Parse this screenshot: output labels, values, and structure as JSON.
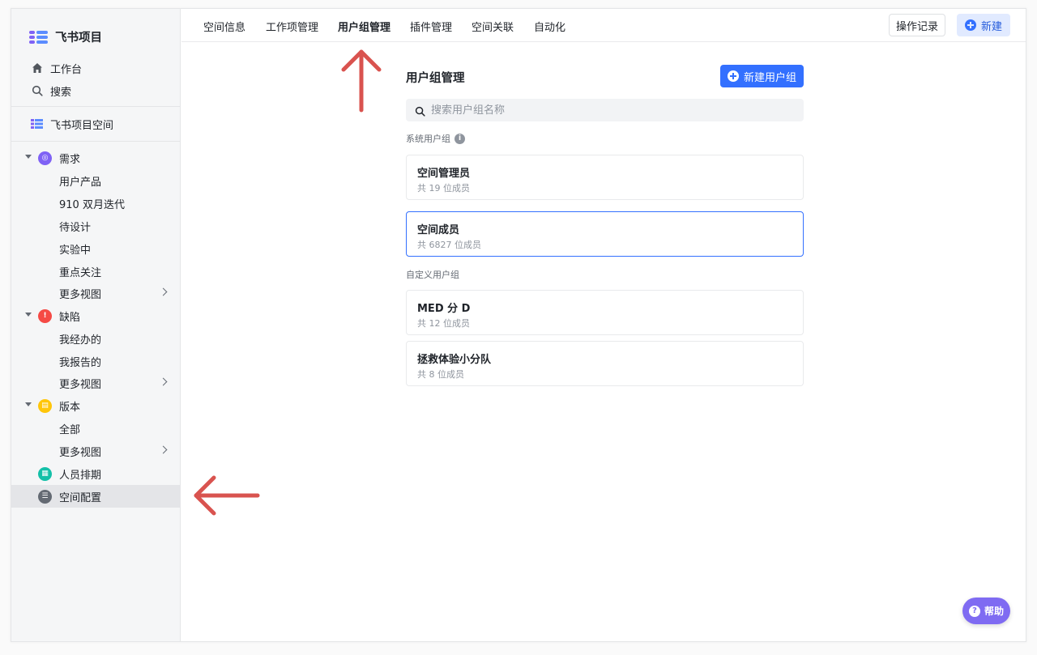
{
  "app": {
    "name": "飞书项目"
  },
  "sidebar": {
    "home": "工作台",
    "search": "搜索",
    "space": "飞书项目空间",
    "categories": [
      {
        "label": "需求",
        "color": "#7f62f5",
        "items": [
          "用户产品",
          "910 双月迭代",
          "待设计",
          "实验中",
          "重点关注",
          "更多视图"
        ]
      },
      {
        "label": "缺陷",
        "color": "#f54a45",
        "items": [
          "我经办的",
          "我报告的",
          "更多视图"
        ]
      },
      {
        "label": "版本",
        "color": "#ffc60a",
        "items": [
          "全部",
          "更多视图"
        ]
      }
    ],
    "schedule": "人员排期",
    "config": "空间配置"
  },
  "topnav": {
    "tabs": [
      "空间信息",
      "工作项管理",
      "用户组管理",
      "插件管理",
      "空间关联",
      "自动化"
    ],
    "active_tab": "用户组管理",
    "log_button": "操作记录",
    "new_button": "新建"
  },
  "main": {
    "title": "用户组管理",
    "create_button": "新建用户组",
    "search_placeholder": "搜索用户组名称",
    "system_section": "系统用户组",
    "system_groups": [
      {
        "name": "空间管理员",
        "members": "共 19 位成员"
      },
      {
        "name": "空间成员",
        "members": "共 6827 位成员"
      }
    ],
    "custom_section": "自定义用户组",
    "custom_groups": [
      {
        "name": "MED 分 D",
        "members": "共 12 位成员"
      },
      {
        "name": "拯救体验小分队",
        "members": "共 8 位成员"
      }
    ]
  },
  "help": {
    "label": "帮助"
  },
  "colors": {
    "accent": "#3370ff",
    "help": "#7f6bf2",
    "annotation_arrow": "#d9534f"
  }
}
